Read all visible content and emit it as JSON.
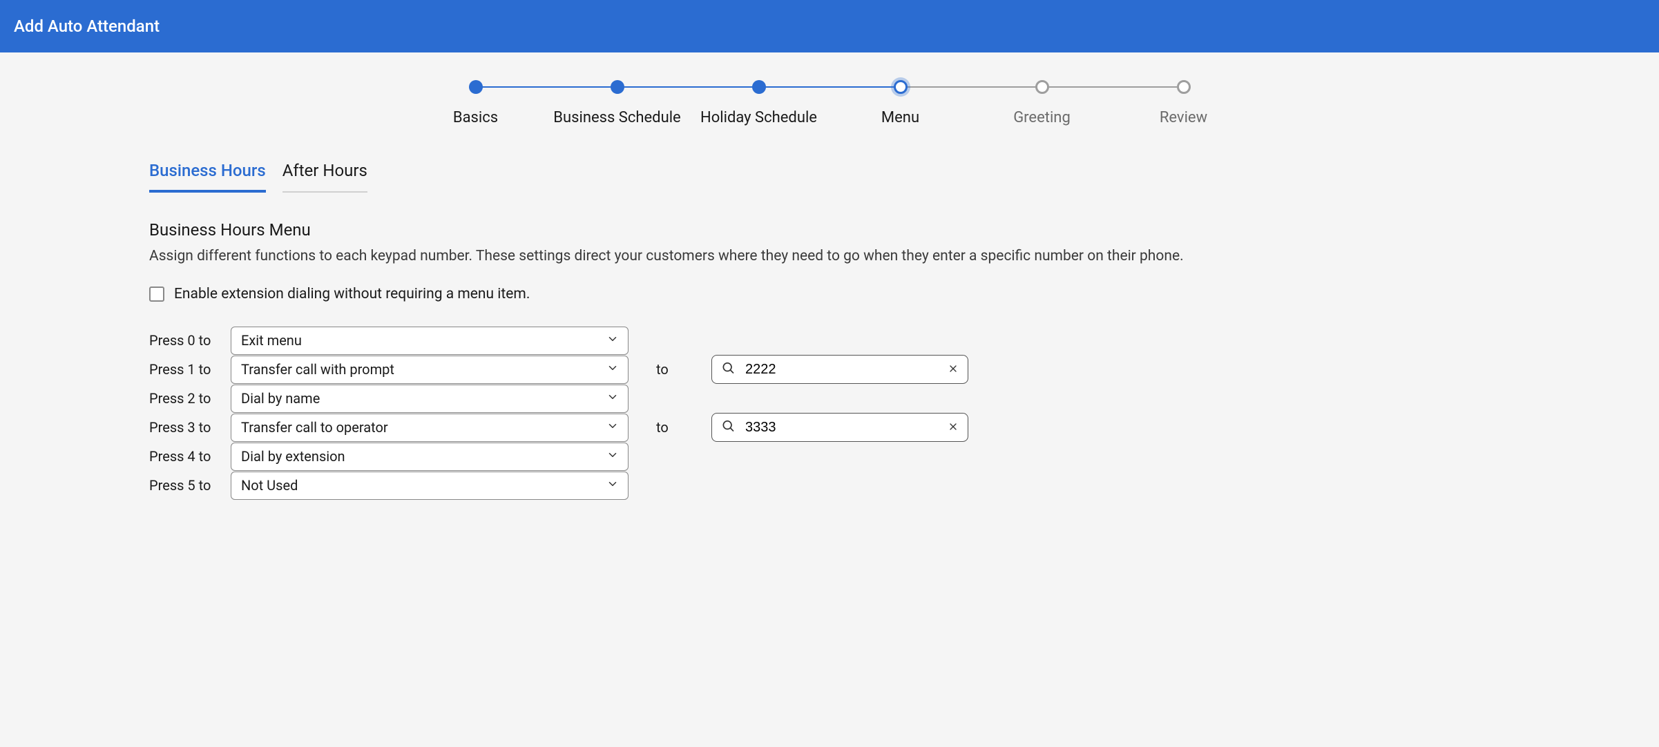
{
  "header": {
    "title": "Add Auto Attendant"
  },
  "stepper": {
    "steps": [
      {
        "label": "Basics",
        "state": "done"
      },
      {
        "label": "Business Schedule",
        "state": "done"
      },
      {
        "label": "Holiday Schedule",
        "state": "done"
      },
      {
        "label": "Menu",
        "state": "current"
      },
      {
        "label": "Greeting",
        "state": "future"
      },
      {
        "label": "Review",
        "state": "future"
      }
    ]
  },
  "tabs": {
    "items": [
      {
        "label": "Business Hours",
        "active": true
      },
      {
        "label": "After Hours",
        "active": false
      }
    ]
  },
  "section": {
    "title": "Business Hours Menu",
    "description": "Assign different functions to each keypad number. These settings direct your customers where they need to go when they enter a specific number on their phone."
  },
  "checkbox": {
    "label": "Enable extension dialing without requiring a menu item.",
    "checked": false
  },
  "menu": {
    "to_label": "to",
    "rows": [
      {
        "label": "Press 0 to",
        "action": "Exit menu",
        "has_target": false,
        "target": ""
      },
      {
        "label": "Press 1 to",
        "action": "Transfer call with prompt",
        "has_target": true,
        "target": "2222"
      },
      {
        "label": "Press 2 to",
        "action": "Dial by name",
        "has_target": false,
        "target": ""
      },
      {
        "label": "Press 3 to",
        "action": "Transfer call to operator",
        "has_target": true,
        "target": "3333"
      },
      {
        "label": "Press 4 to",
        "action": "Dial by extension",
        "has_target": false,
        "target": ""
      },
      {
        "label": "Press 5 to",
        "action": "Not Used",
        "has_target": false,
        "target": ""
      }
    ]
  }
}
